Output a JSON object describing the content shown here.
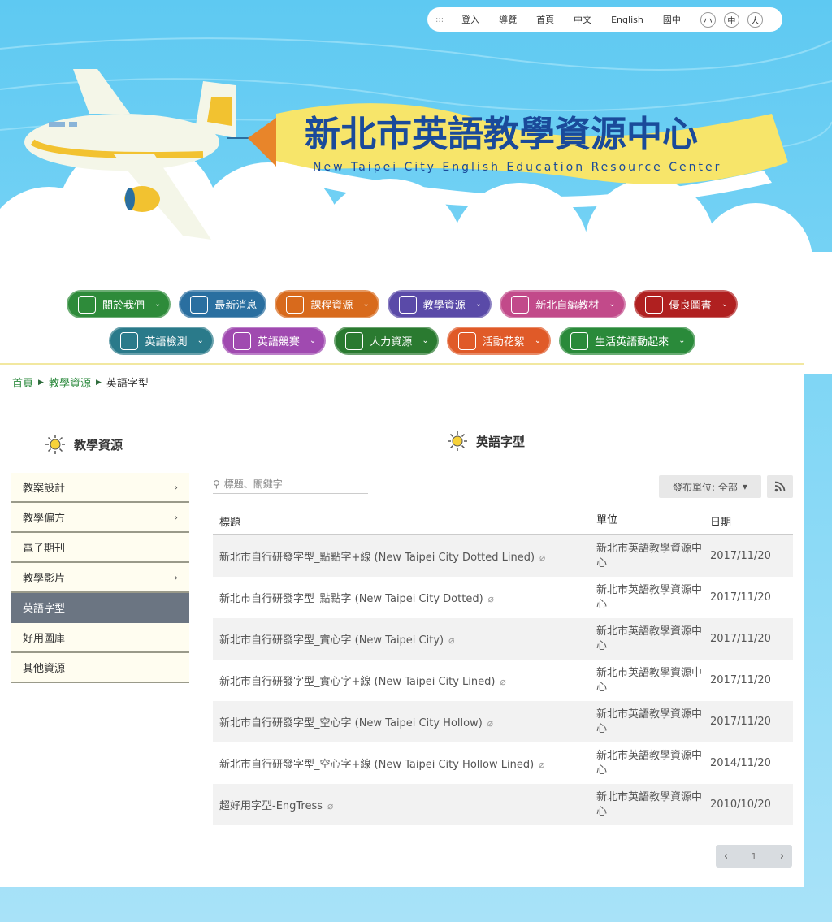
{
  "topbar": {
    "accesskey": ":::",
    "links": [
      "登入",
      "導覽",
      "首頁",
      "中文",
      "English",
      "國中"
    ],
    "sizes": [
      "小",
      "中",
      "大"
    ]
  },
  "banner": {
    "title": "新北市英語教學資源中心",
    "subtitle": "New Taipei City English Education Resource Center"
  },
  "nav": {
    "row1": [
      {
        "label": "關於我們",
        "color": "#2e8b3a"
      },
      {
        "label": "最新消息",
        "color": "#2a6fa0"
      },
      {
        "label": "課程資源",
        "color": "#d86a1c"
      },
      {
        "label": "教學資源",
        "color": "#5a4aa8"
      },
      {
        "label": "新北自編教材",
        "color": "#c24a8a"
      },
      {
        "label": "優良圖書",
        "color": "#b02020"
      }
    ],
    "row2": [
      {
        "label": "英語檢測",
        "color": "#2a7a8a"
      },
      {
        "label": "英語競賽",
        "color": "#a04ab0"
      },
      {
        "label": "人力資源",
        "color": "#2a7a30"
      },
      {
        "label": "活動花絮",
        "color": "#e05a28"
      },
      {
        "label": "生活英語動起來",
        "color": "#2a8a3a"
      }
    ]
  },
  "breadcrumb": [
    "首頁",
    "教學資源",
    "英語字型"
  ],
  "sidebar": {
    "title": "教學資源",
    "items": [
      {
        "label": "教案設計",
        "chevron": true,
        "active": false
      },
      {
        "label": "教學偏方",
        "chevron": true,
        "active": false
      },
      {
        "label": "電子期刊",
        "chevron": false,
        "active": false
      },
      {
        "label": "教學影片",
        "chevron": true,
        "active": false
      },
      {
        "label": "英語字型",
        "chevron": false,
        "active": true
      },
      {
        "label": "好用圖庫",
        "chevron": false,
        "active": false
      },
      {
        "label": "其他資源",
        "chevron": false,
        "active": false
      }
    ]
  },
  "main": {
    "title": "英語字型",
    "search_placeholder": "標題、關鍵字",
    "filter_label": "發布單位: 全部",
    "columns": [
      "標題",
      "單位",
      "日期"
    ],
    "rows": [
      {
        "title": "新北市自行研發字型_點點字+線 (New Taipei City Dotted Lined)",
        "unit": "新北市英語教學資源中心",
        "date": "2017/11/20"
      },
      {
        "title": "新北市自行研發字型_點點字 (New Taipei City Dotted)",
        "unit": "新北市英語教學資源中心",
        "date": "2017/11/20"
      },
      {
        "title": "新北市自行研發字型_實心字 (New Taipei City)",
        "unit": "新北市英語教學資源中心",
        "date": "2017/11/20"
      },
      {
        "title": "新北市自行研發字型_實心字+線 (New Taipei City Lined)",
        "unit": "新北市英語教學資源中心",
        "date": "2017/11/20"
      },
      {
        "title": "新北市自行研發字型_空心字 (New Taipei City Hollow)",
        "unit": "新北市英語教學資源中心",
        "date": "2017/11/20"
      },
      {
        "title": "新北市自行研發字型_空心字+線 (New Taipei City Hollow Lined)",
        "unit": "新北市英語教學資源中心",
        "date": "2014/11/20"
      },
      {
        "title": "超好用字型-EngTress",
        "unit": "新北市英語教學資源中心",
        "date": "2010/10/20"
      }
    ],
    "page": "1"
  }
}
